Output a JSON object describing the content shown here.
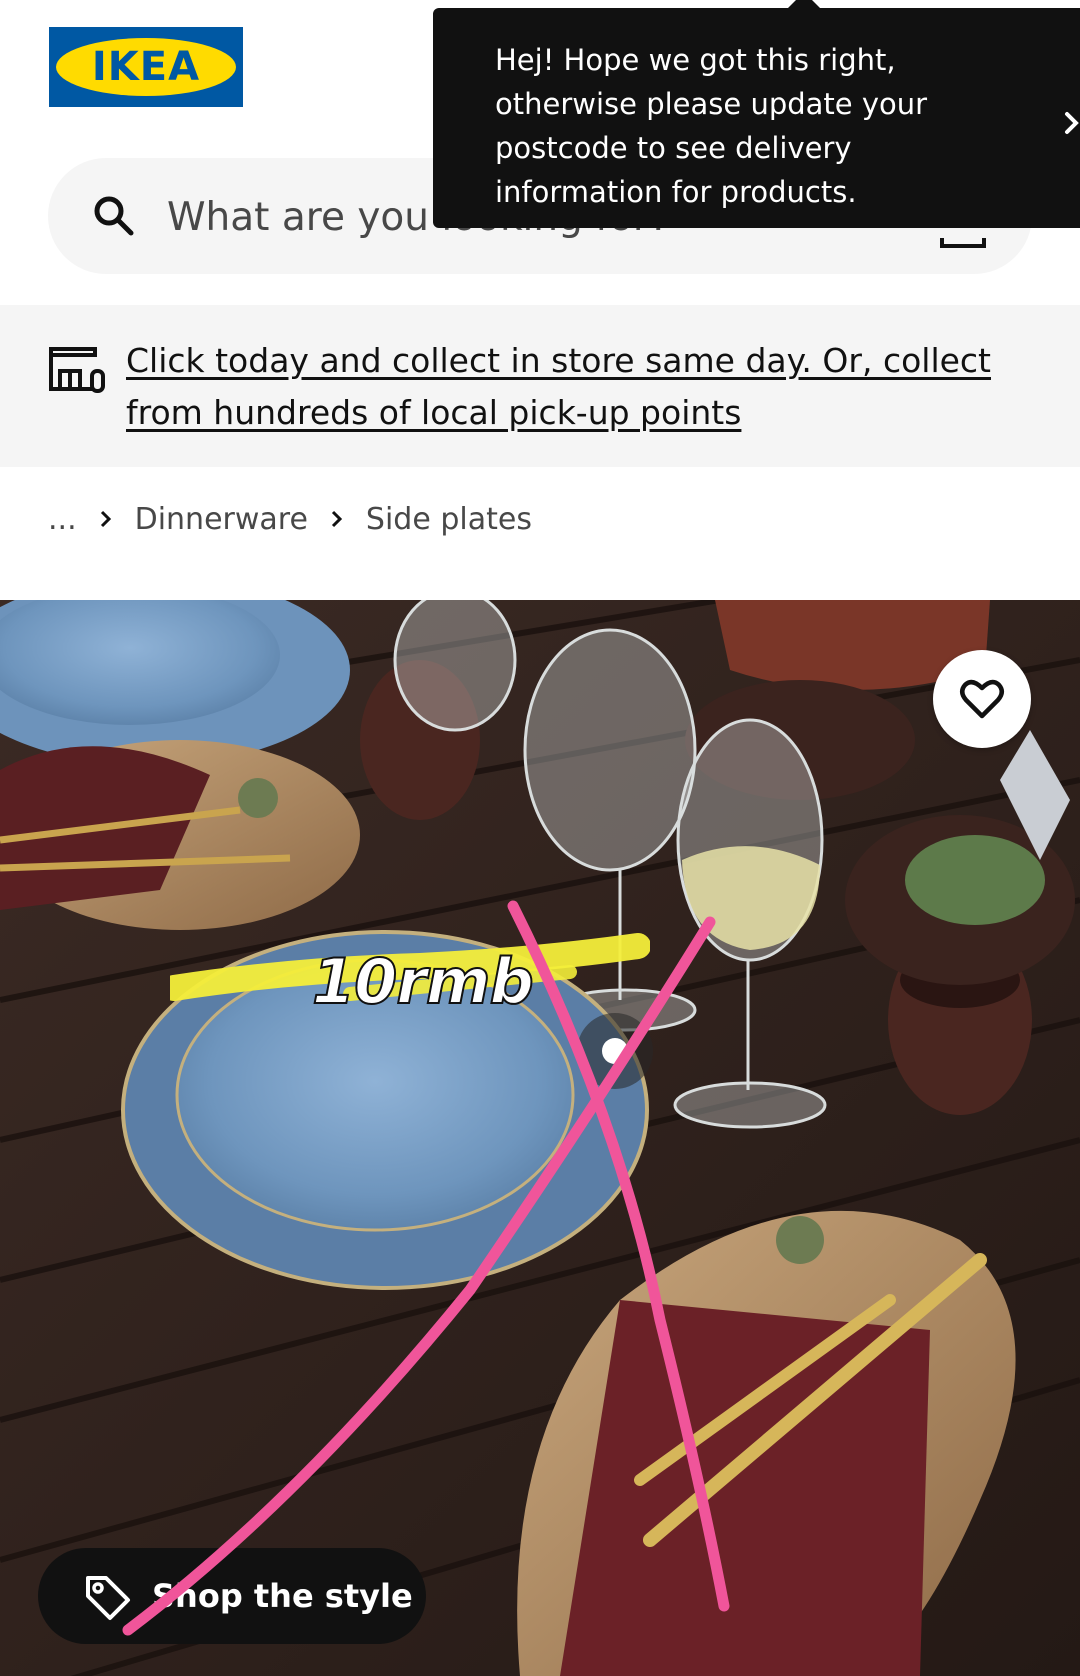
{
  "header": {
    "logo_text": "IKEA",
    "search": {
      "placeholder": "What are you looking for?"
    }
  },
  "tooltip": {
    "text": "Hej! Hope we got this right, otherwise please update your postcode to see delivery information for products."
  },
  "notice": {
    "text": "Click today and collect in store same day. Or, collect from hundreds of local pick-up points"
  },
  "breadcrumb": {
    "ellipsis": "...",
    "items": [
      "Dinnerware",
      "Side plates"
    ]
  },
  "hero": {
    "shop_the_style_label": "Shop the style",
    "annotation_price": "10rmb"
  },
  "colors": {
    "ikea_blue": "#0058a3",
    "ikea_yellow": "#ffdb00",
    "annotation_pink": "#f0559a",
    "annotation_yellow": "#f4ee3a"
  },
  "icons": {
    "search": "search-icon",
    "camera": "camera-icon",
    "close": "close-icon",
    "store": "store-icon",
    "chevron": "chevron-right-icon",
    "favourite": "heart-icon",
    "tag": "tag-icon"
  }
}
